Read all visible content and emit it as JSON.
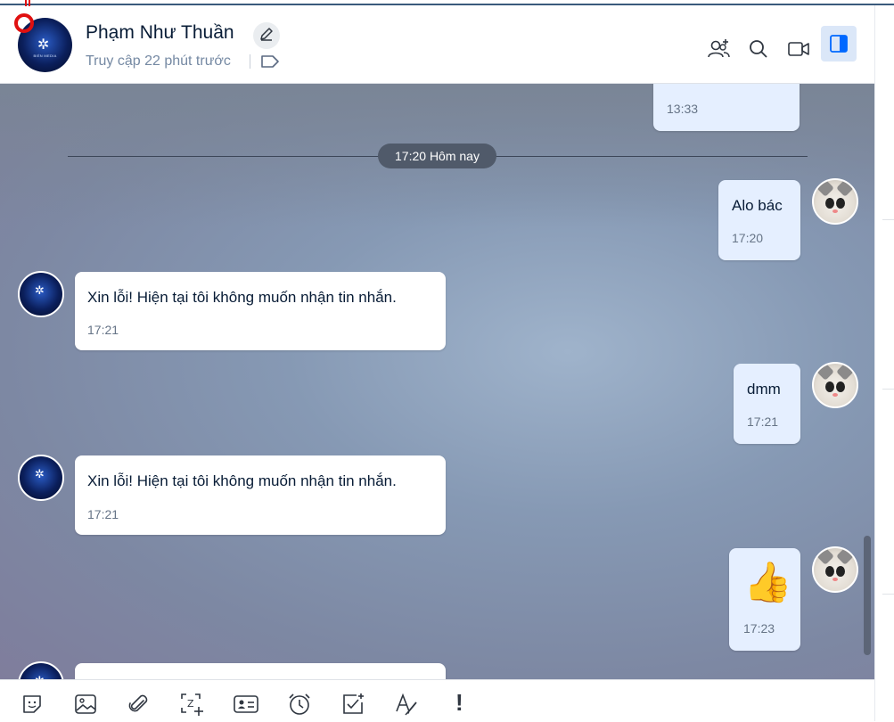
{
  "header": {
    "contact_name": "Phạm Như Thuần",
    "status": "Truy cập 22 phút trước"
  },
  "icons": {
    "edit": "pencil-icon",
    "tag": "tag-icon",
    "add_member": "add-member-icon",
    "search": "search-icon",
    "video": "video-call-icon",
    "sidebar": "sidebar-toggle-icon"
  },
  "colors": {
    "accent": "#0068ff",
    "outgoing_bubble": "#e5efff",
    "incoming_bubble": "#ffffff",
    "divider_pill": "#505a6a"
  },
  "messages": {
    "m0": {
      "time": "13:33"
    },
    "divider": "17:20 Hôm nay",
    "m1": {
      "text": "Alo bác",
      "time": "17:20"
    },
    "m2": {
      "text": "Xin lỗi! Hiện tại tôi không muốn nhận tin nhắn.",
      "time": "17:21"
    },
    "m3": {
      "text": "dmm",
      "time": "17:21"
    },
    "m4": {
      "text": "Xin lỗi! Hiện tại tôi không muốn nhận tin nhắn.",
      "time": "17:21"
    },
    "m5": {
      "emoji": "👍",
      "time": "17:23"
    }
  },
  "toolbar": {
    "items": [
      "sticker-icon",
      "image-icon",
      "attachment-icon",
      "screenshot-icon",
      "contact-card-icon",
      "reminder-icon",
      "task-icon",
      "format-text-icon",
      "urgent-icon"
    ],
    "urgent_label": "!"
  }
}
